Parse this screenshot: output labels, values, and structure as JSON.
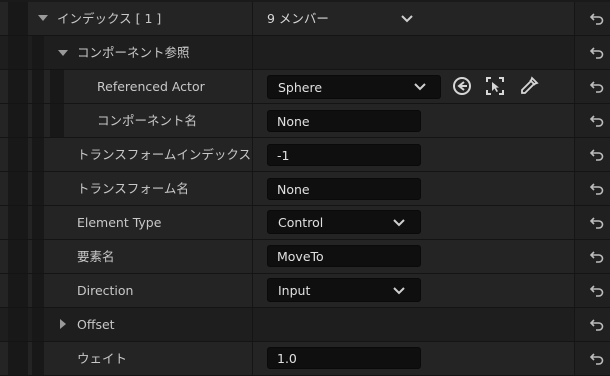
{
  "rows": {
    "index": {
      "label": "インデックス [ 1 ]",
      "value": "9 メンバー"
    },
    "component_ref": {
      "label": "コンポーネント参照"
    },
    "referenced_actor": {
      "label": "Referenced Actor",
      "value": "Sphere"
    },
    "component_name": {
      "label": "コンポーネント名",
      "value": "None"
    },
    "transform_index": {
      "label": "トランスフォームインデックス",
      "value": "-1"
    },
    "transform_name": {
      "label": "トランスフォーム名",
      "value": "None"
    },
    "element_type": {
      "label": "Element Type",
      "value": "Control"
    },
    "element_name": {
      "label": "要素名",
      "value": "MoveTo"
    },
    "direction": {
      "label": "Direction",
      "value": "Input"
    },
    "offset": {
      "label": "Offset"
    },
    "weight": {
      "label": "ウェイト",
      "value": "1.0"
    }
  },
  "icons": {
    "reset": "reset-arrow-icon",
    "use_selected": "arrow-left-circle-icon",
    "browse": "select-actor-icon",
    "pick": "eyedropper-icon"
  }
}
